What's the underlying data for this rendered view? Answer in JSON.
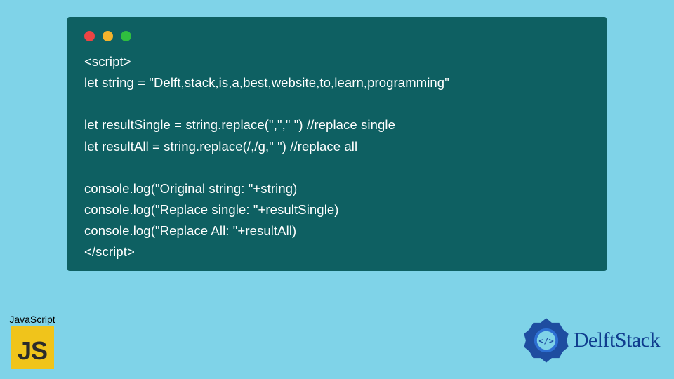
{
  "code": {
    "lines": [
      "<script>",
      "let string = \"Delft,stack,is,a,best,website,to,learn,programming\"",
      "",
      "let resultSingle = string.replace(\",\",\" \") //replace single",
      "let resultAll = string.replace(/,/g,\" \") //replace all",
      "",
      "console.log(\"Original string: \"+string)",
      "console.log(\"Replace single: \"+resultSingle)",
      "console.log(\"Replace All: \"+resultAll)",
      "</script>"
    ]
  },
  "js_badge": {
    "label": "JavaScript",
    "glyph": "JS"
  },
  "delftstack": {
    "text": "DelftStack"
  },
  "colors": {
    "page_bg": "#7FD3E8",
    "panel_bg": "#0E6062",
    "js_yellow": "#F0C41B",
    "brand_blue": "#0F3C8E"
  }
}
